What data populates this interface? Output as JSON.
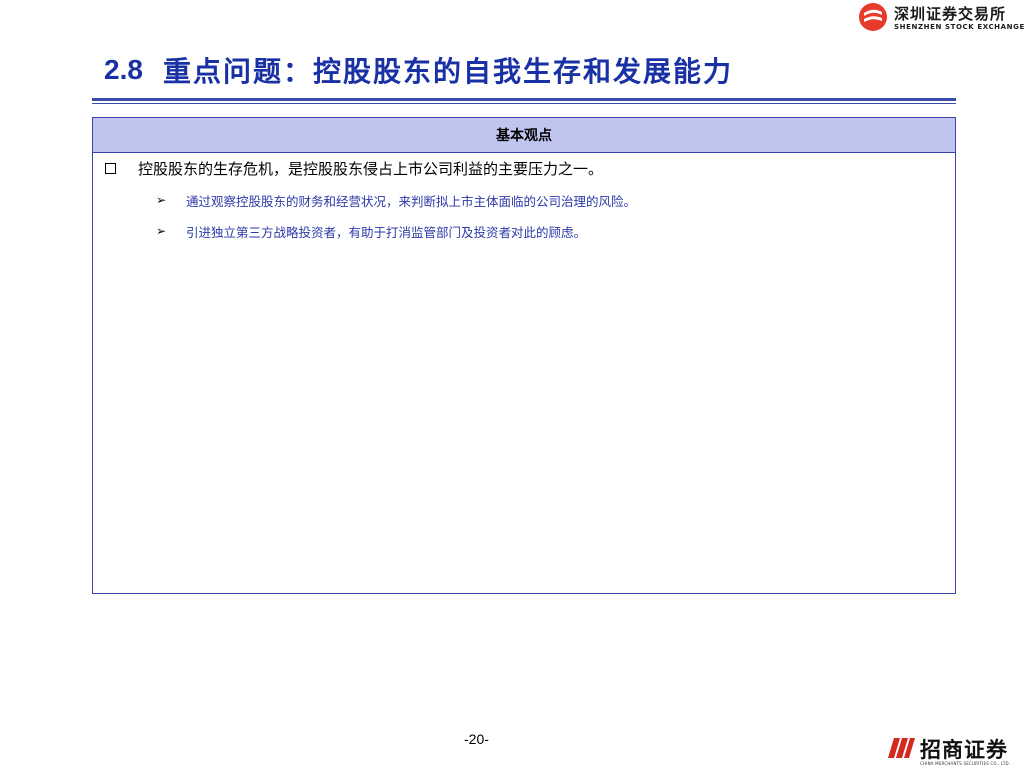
{
  "header_logo": {
    "name_cn": "深圳证券交易所",
    "name_en": "SHENZHEN STOCK EXCHANGE",
    "mark_color": "#e63a2a"
  },
  "slide": {
    "number": "2.8",
    "title": "重点问题：控股股东的自我生存和发展能力",
    "title_color": "#1a31a6"
  },
  "box": {
    "header": "基本观点",
    "header_bg": "#bfc5ee",
    "main_bullet_icon": "checkbox-icon",
    "main_point": "控股股东的生存危机，是控股股东侵占上市公司利益的主要压力之一。",
    "sub_bullet_icon": "arrow-bullet-icon",
    "sub_points": [
      "通过观察控股股东的财务和经营状况，来判断拟上市主体面临的公司治理的风险。",
      "引进独立第三方战略投资者，有助于打消监管部门及投资者对此的顾虑。"
    ],
    "sub_text_color": "#2b3aa8"
  },
  "footer": {
    "page": "-20-",
    "logo_cn": "招商证券",
    "logo_en": "CHINA MERCHANTS SECURITIES CO., LTD.",
    "logo_color": "#d42a1e"
  }
}
